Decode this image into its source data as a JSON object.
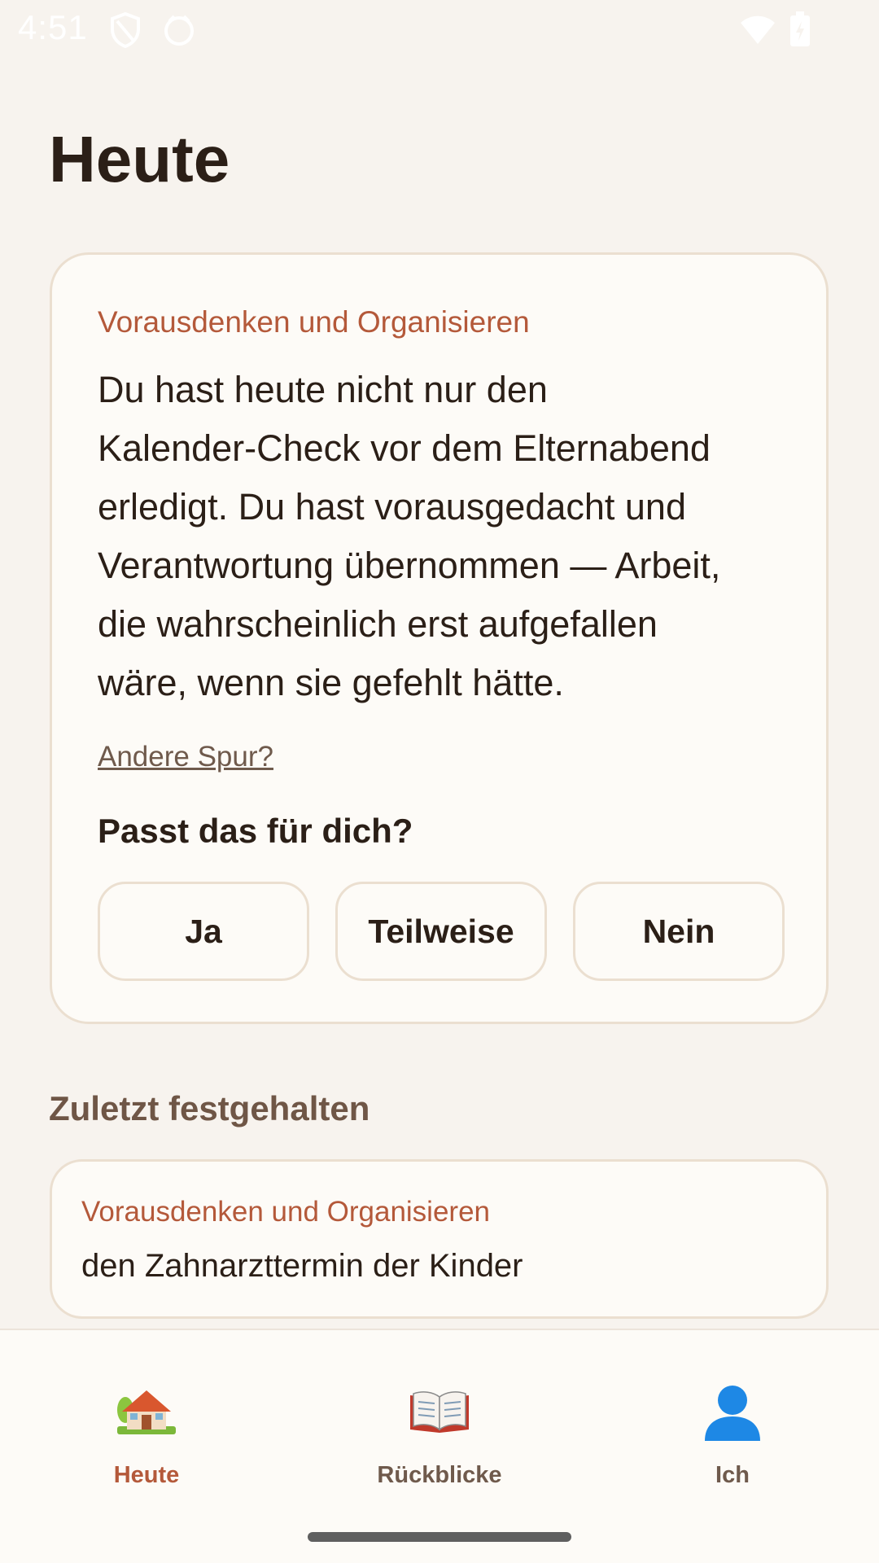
{
  "status_bar": {
    "time": "4:51"
  },
  "page_title": "Heute",
  "insight_card": {
    "category": "Vorausdenken und Organisieren",
    "lines": [
      "Du hast heute nicht nur den",
      "Kalender-Check vor dem Elternabend",
      "erledigt. Du hast vorausgedacht und",
      "Verantwortung übernommen — Arbeit,",
      "die wahrscheinlich erst aufgefallen",
      "wäre, wenn sie gefehlt hätte."
    ],
    "alt_link": "Andere Spur?",
    "question": "Passt das für dich?",
    "answers": {
      "yes": "Ja",
      "partly": "Teilweise",
      "no": "Nein"
    }
  },
  "recent": {
    "title": "Zuletzt festgehalten",
    "items": [
      {
        "category": "Vorausdenken und Organisieren",
        "text": "den Zahnarzttermin der Kinder"
      }
    ]
  },
  "nav": {
    "items": [
      {
        "label": "Heute",
        "icon": "house-icon",
        "active": true
      },
      {
        "label": "Rückblicke",
        "icon": "open-book-icon",
        "active": false
      },
      {
        "label": "Ich",
        "icon": "person-icon",
        "active": false
      }
    ]
  },
  "colors": {
    "background": "#f7f3ee",
    "card": "#fdfbf7",
    "card_border": "#ebdfd0",
    "accent": "#b4593a",
    "text": "#2b1f17",
    "muted": "#6f5a4c"
  }
}
